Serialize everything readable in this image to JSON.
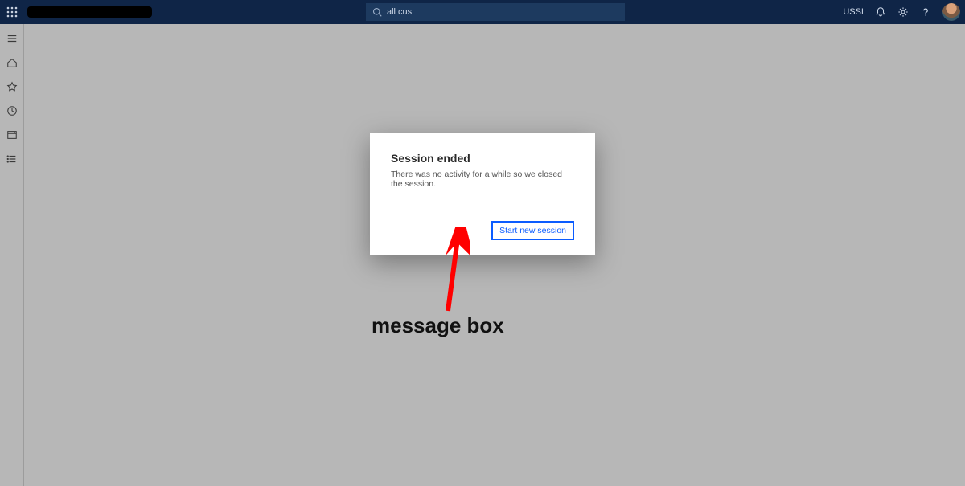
{
  "topbar": {
    "search_value": "all cus",
    "company_code": "USSI"
  },
  "dialog": {
    "title": "Session ended",
    "message": "There was no activity for a while so we closed the session.",
    "button_label": "Start new session"
  },
  "annotation": {
    "label": "message box"
  }
}
